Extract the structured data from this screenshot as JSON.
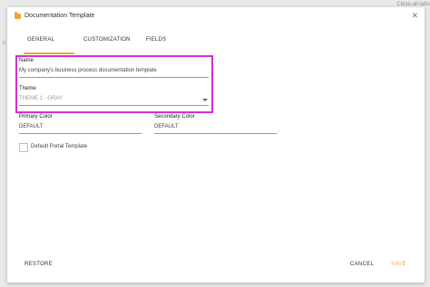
{
  "background": {
    "right_text": "Close-all-tabs",
    "left_text": "s"
  },
  "modal": {
    "title": "Documentation Template",
    "close_icon": "close-icon",
    "tabs": [
      {
        "label": "GENERAL",
        "active": true
      },
      {
        "label": "CUSTOMIZATION",
        "active": false
      },
      {
        "label": "FIELDS",
        "active": false
      }
    ],
    "fields": {
      "name": {
        "label": "Name",
        "value": "My company's business process documentation template"
      },
      "theme": {
        "label": "Theme",
        "value": "THEME 1 - GRAY"
      },
      "primary_color": {
        "label": "Primary Color",
        "value": "DEFAULT"
      },
      "secondary_color": {
        "label": "Secondary Color",
        "value": "DEFAULT"
      }
    },
    "checkbox": {
      "label": "Default Portal Template",
      "checked": false
    },
    "buttons": {
      "restore": "RESTORE",
      "cancel": "CANCEL",
      "save": "SAVE"
    }
  },
  "colors": {
    "accent": "#f2a536",
    "highlight_border": "#d42fd4"
  }
}
